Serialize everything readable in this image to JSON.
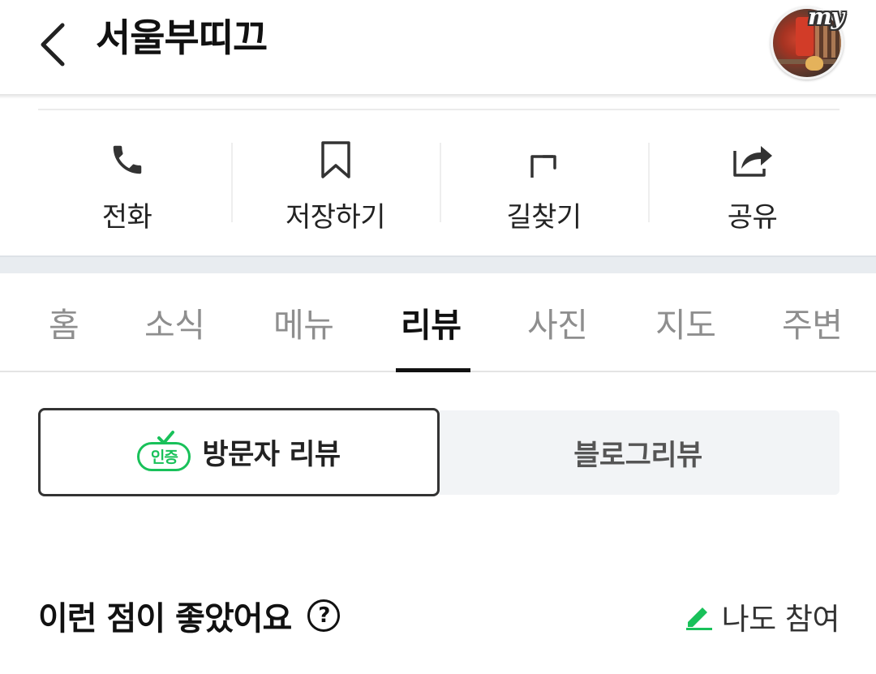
{
  "header": {
    "title": "서울부띠끄",
    "back_icon": "chevron-left-icon",
    "my_badge": "my"
  },
  "actions": [
    {
      "label": "전화",
      "icon": "phone-icon"
    },
    {
      "label": "저장하기",
      "icon": "bookmark-icon"
    },
    {
      "label": "길찾기",
      "icon": "directions-icon"
    },
    {
      "label": "공유",
      "icon": "share-icon"
    }
  ],
  "tabs": [
    {
      "label": "홈"
    },
    {
      "label": "소식"
    },
    {
      "label": "메뉴"
    },
    {
      "label": "리뷰",
      "active": true
    },
    {
      "label": "사진"
    },
    {
      "label": "지도"
    },
    {
      "label": "주변"
    }
  ],
  "review_toggle": {
    "badge": "인증",
    "visitor_label": "방문자 리뷰",
    "blog_label": "블로그리뷰"
  },
  "section": {
    "title": "이런 점이 좋았어요",
    "help_symbol": "?",
    "join_label": "나도 참여"
  },
  "colors": {
    "accent_green": "#19c15a",
    "tab_inactive": "#8e8e8e",
    "band_gray": "#e8ecf0"
  }
}
